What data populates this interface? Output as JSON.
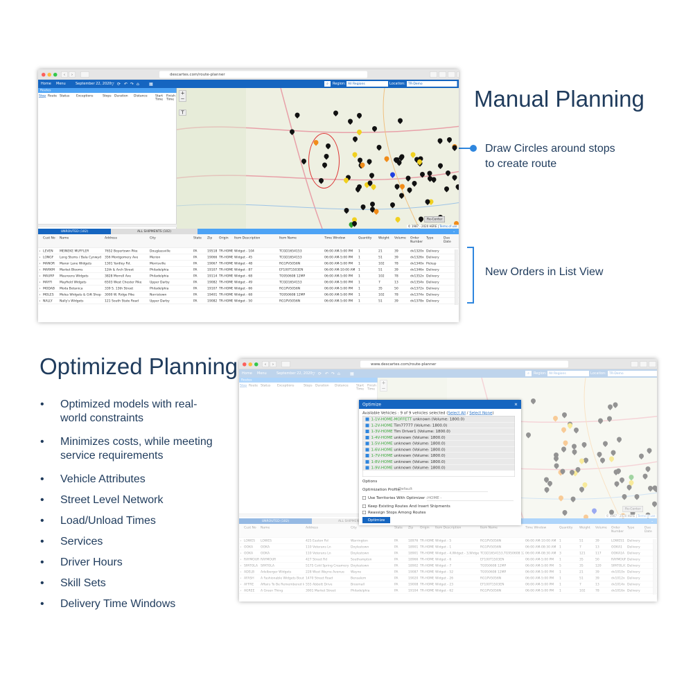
{
  "manual": {
    "title": "Manual Planning",
    "callout1": "Draw Circles around stops to create route",
    "callout2": "New Orders in List View"
  },
  "optimized": {
    "title": "Optimized Planning",
    "bullets": [
      "Optimized models with real-world constraints",
      "Minimizes costs, while meeting service requirements",
      "Vehicle Attributes",
      "Street Level Network",
      "Load/Unload Times",
      "Services",
      "Driver Hours",
      "Skill Sets",
      "Delivery Time Windows"
    ]
  },
  "colors": {
    "nav": "#1565c0",
    "panel": "#4da3f5",
    "text": "#1f3b5c",
    "circle": "#d33"
  },
  "app": {
    "nav": {
      "home": "Home",
      "menu": "Menu",
      "region_label": "Region:",
      "region_value": "All Regions",
      "location_label": "Location:",
      "location_value": "TR-Demo"
    },
    "routes": {
      "title": "Routes",
      "columns": [
        "Stop",
        "Route",
        "Status",
        "Exceptions",
        "Stops",
        "Duration",
        "Distance",
        "Start Time",
        "Finish Time"
      ]
    },
    "map": {
      "recenter": "Re-Center",
      "copyright": "© 1987 - 2020 HERE",
      "terms": "Terms of use"
    },
    "columns": [
      "Cust No",
      "Name",
      "Address",
      "City",
      "State",
      "Zip",
      "Origin",
      "Item Description",
      "Item Name",
      "Time Window",
      "Quantity",
      "Weight",
      "Volume",
      "Order Number",
      "Type",
      "Due Date"
    ]
  },
  "window1": {
    "url": "descartes.com/route-planner",
    "date": "September 22, 2020",
    "tabs": [
      "UNROUTED (102)",
      "ALL SHIPMENTS (102)"
    ],
    "rows": [
      [
        "LEVEN",
        "MEINEKE MUFFLER",
        "7652 Boyertown Pike",
        "Douglassville",
        "PA",
        "19518",
        "TR-HOME",
        "Widget - 104",
        "TCGD1654153",
        "06:00 AM-5:00 PM",
        "1",
        "21",
        "39",
        "dv1320x",
        "Delivery",
        ""
      ],
      [
        "LONGF",
        "Long Stems / Bala Cynwyd",
        "356 Montgomery Ave",
        "Merion",
        "PA",
        "19066",
        "TR-HOME",
        "Widget - 45",
        "TCGD1654153",
        "06:00 AM-5:00 PM",
        "1",
        "51",
        "39",
        "dv1326x",
        "Delivery",
        ""
      ],
      [
        "MANOR",
        "Manor Lane Widgets",
        "1301 Yardley Rd.",
        "Morrisville",
        "PA",
        "19067",
        "TR-HOME",
        "Widget - 48",
        "RG1PV5056N",
        "06:00 AM-5:00 PM",
        "1",
        "102",
        "78",
        "dv1340x",
        "Pickup",
        ""
      ],
      [
        "MARKM",
        "Market Blooms",
        "12th & Arch Street",
        "Philadelphia",
        "PA",
        "19107",
        "TR-HOME",
        "Widget - 87",
        "EF100T1503EN",
        "06:00 AM-10:00 AM",
        "1",
        "51",
        "39",
        "dv1346x",
        "Delivery",
        ""
      ],
      [
        "MAURP",
        "Maureens Widgets",
        "3828 Morrell Ave",
        "Philadelphia",
        "PA",
        "19114",
        "TR-HOME",
        "Widget - 68",
        "TG950608 12MP",
        "06:00 AM-5:00 PM",
        "1",
        "102",
        "78",
        "dv1352x",
        "Delivery",
        ""
      ],
      [
        "MAYFI",
        "Mayfield Widgets",
        "6503 West Chester Pike",
        "Upper Darby",
        "PA",
        "19082",
        "TR-HOME",
        "Widget - 49",
        "TCGD1654153",
        "06:00 AM-5:00 PM",
        "1",
        "7",
        "13",
        "dv1354x",
        "Delivery",
        ""
      ],
      [
        "MODAB",
        "Moda Botanica",
        "339 S. 13th Street",
        "Philadelphia",
        "PA",
        "19107",
        "TR-HOME",
        "Widget - 66",
        "RG1PV5056N",
        "06:00 AM-5:00 PM",
        "1",
        "35",
        "50",
        "dv1372x",
        "Delivery",
        ""
      ],
      [
        "MOLES",
        "Moles Widgets & Gift Shop",
        "3000 W. Ridge Pike",
        "Norristown",
        "PA",
        "19401",
        "TR-HOME",
        "Widget - 68",
        "TG950608 12MP",
        "06:00 AM-5:00 PM",
        "1",
        "102",
        "78",
        "dv1374x",
        "Delivery",
        ""
      ],
      [
        "NALLY",
        "Nally's Widgets",
        "121 South State Road",
        "Upper Darby",
        "PA",
        "19082",
        "TR-HOME",
        "Widget - 50",
        "RG1PV5056N",
        "06:00 AM-5:00 PM",
        "1",
        "51",
        "39",
        "dv1378x",
        "Delivery",
        ""
      ]
    ]
  },
  "window2": {
    "url": "www.descartes.com/route-planner",
    "date": "September 22, 2020",
    "tabs": [
      "UNROUTED (102)",
      "ALL SHIPMENTS (102)"
    ],
    "rows": [
      [
        "LOWES",
        "LOWES",
        "425 Easton Rd",
        "Warrington",
        "PA",
        "18976",
        "TR-HOME",
        "Widget - 5",
        "RG1PV5056N",
        "06:00 AM-10:00 AM",
        "1",
        "51",
        "39",
        "LOWES1",
        "Delivery",
        ""
      ],
      [
        "OOKA",
        "OOKA",
        "110 Veterans Ln",
        "Doylestown",
        "PA",
        "18901",
        "TR-HOME",
        "Widget - 1",
        "RG1PV5056N",
        "06:00 AM-08:30 AM",
        "1",
        "7",
        "13",
        "OOKA1",
        "Delivery",
        ""
      ],
      [
        "OOKA",
        "OOKA",
        "110 Veterans Ln",
        "Doylestown",
        "PA",
        "18901",
        "TR-HOME",
        "Widget - 4,Widget - 3,Widget",
        "TCGD1654153,TG950608 12MP",
        "06:00 AM-08:30 AM",
        "3",
        "121",
        "117",
        "OOKA1A",
        "Delivery",
        ""
      ],
      [
        "RAYMOUR",
        "RAYMOUR",
        "427 Street Rd",
        "Southampton",
        "PA",
        "18966",
        "TR-HOME",
        "Widget - 6",
        "EF100T1503EN",
        "06:00 AM-5:00 PM",
        "1",
        "35",
        "50",
        "RAYMOUR",
        "Delivery",
        ""
      ],
      [
        "SPATOLA",
        "SPATOLA",
        "5175 Cold Spring Creamery Rd",
        "Doylestown",
        "PA",
        "18902",
        "TR-HOME",
        "Widget - 7",
        "TG950608 12MP",
        "06:00 AM-5:00 PM",
        "5",
        "35",
        "120",
        "SPATOLA1",
        "Delivery",
        ""
      ],
      [
        "ADELB",
        "Adelberger Widgets",
        "228 West Wayne Avenue",
        "Wayne",
        "PA",
        "19087",
        "TR-HOME",
        "Widget - 52",
        "TG950608 12MP",
        "06:00 AM-5:00 PM",
        "1",
        "21",
        "39",
        "dv1010x",
        "Delivery",
        ""
      ],
      [
        "AFASH",
        "A Fashionable Widgets Boutique",
        "1470 Street Road",
        "Bensalem",
        "PA",
        "19020",
        "TR-HOME",
        "Widget - 26",
        "RG1PV5056N",
        "06:00 AM-5:00 PM",
        "1",
        "51",
        "39",
        "dv1012x",
        "Delivery",
        ""
      ],
      [
        "AFFRE",
        "Affairs To Be Remembered Inc",
        "555 Abbott Drive",
        "Broomall",
        "PA",
        "19008",
        "TR-HOME",
        "Widget - 23",
        "EF100T1503EN",
        "06:00 AM-5:00 PM",
        "1",
        "7",
        "13",
        "dv1014x",
        "Delivery",
        ""
      ],
      [
        "AGREE",
        "A Green Thing",
        "3901 Market Street",
        "Philadelphia",
        "PA",
        "19104",
        "TR-HOME",
        "Widget - 62",
        "RG1PV5056N",
        "06:00 AM-5:00 PM",
        "1",
        "102",
        "78",
        "dv1016x",
        "Delivery",
        ""
      ]
    ]
  },
  "optimize": {
    "title": "Optimize",
    "available": "Available Vehicles : 9 of 9 vehicles selected (",
    "select_all": "Select All",
    "slash": " / ",
    "select_none": "Select None",
    "close": ")",
    "vehicles": [
      {
        "id": "1-1V-HOME-MOFFETT",
        "desc": "unknown (Volume: 1800.0)",
        "checked": true
      },
      {
        "id": "1-2V-HOME",
        "desc": "Tim77777 (Volume: 1800.0)",
        "checked": true
      },
      {
        "id": "1-3V-HOME",
        "desc": "Tim Driver1 (Volume: 1800.0)",
        "checked": true
      },
      {
        "id": "1-4V-HOME",
        "desc": "unknown (Volume: 1800.0)",
        "checked": true
      },
      {
        "id": "1-5V-HOME",
        "desc": "unknown (Volume: 1800.0)",
        "checked": true
      },
      {
        "id": "1-6V-HOME",
        "desc": "unknown (Volume: 1800.0)",
        "checked": true
      },
      {
        "id": "1-7V-HOME",
        "desc": "unknown (Volume: 1800.0)",
        "checked": true
      },
      {
        "id": "1-8V-HOME",
        "desc": "unknown (Volume: 1800.0)",
        "checked": true
      },
      {
        "id": "1-9V-HOME",
        "desc": "unknown (Volume: 1800.0)",
        "checked": true
      }
    ],
    "options": "Options",
    "profile_label": "Optimization Profile:",
    "profile_value": "Default",
    "territories": "Use Territories With Optimizer :",
    "territory_value": "HOME -",
    "keep": "Keep Existing Routes And Insert Shipments",
    "reassign": "Reassign Stops Among Routes",
    "button": "Optimize"
  }
}
